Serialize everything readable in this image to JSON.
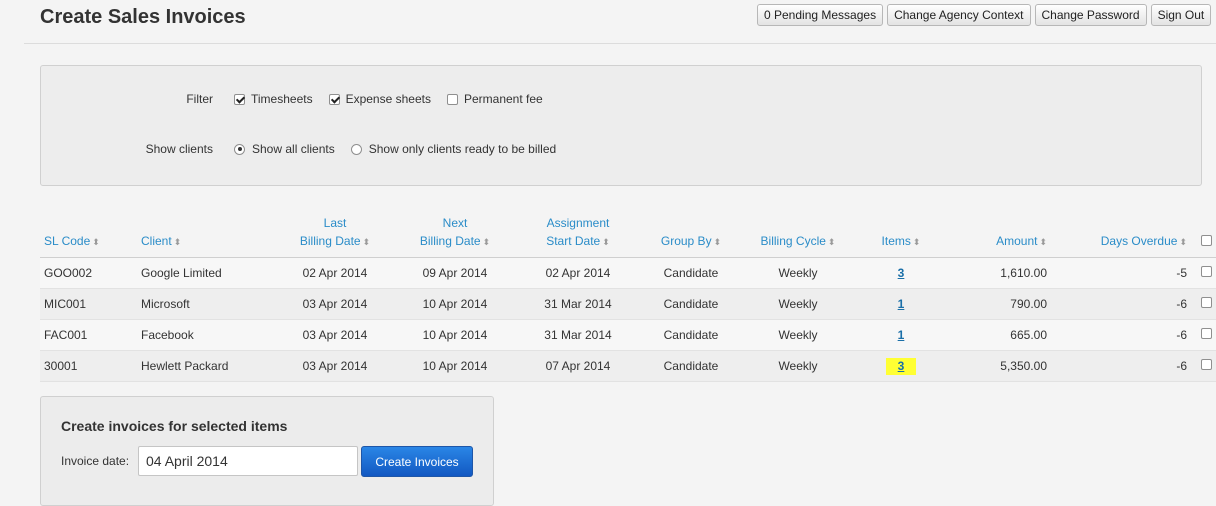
{
  "page": {
    "title": "Create Sales Invoices"
  },
  "top_buttons": {
    "pending": "0 Pending Messages",
    "agency": "Change Agency Context",
    "password": "Change Password",
    "signout": "Sign Out"
  },
  "filter": {
    "filter_label": "Filter",
    "timesheets": {
      "label": "Timesheets",
      "checked": true
    },
    "expense": {
      "label": "Expense sheets",
      "checked": true
    },
    "permanent": {
      "label": "Permanent fee",
      "checked": false
    },
    "show_clients_label": "Show clients",
    "show_all": {
      "label": "Show all clients",
      "selected": true
    },
    "show_ready": {
      "label": "Show only clients ready to be billed",
      "selected": false
    }
  },
  "table": {
    "headers": {
      "sl_code": "SL Code",
      "client": "Client",
      "last_billing_1": "Last",
      "last_billing_2": "Billing Date",
      "next_billing_1": "Next",
      "next_billing_2": "Billing Date",
      "assignment_1": "Assignment",
      "assignment_2": "Start Date",
      "group_by": "Group By",
      "billing_cycle": "Billing Cycle",
      "items": "Items",
      "amount": "Amount",
      "days_overdue": "Days Overdue"
    },
    "rows": [
      {
        "sl_code": "GOO002",
        "client": "Google Limited",
        "last": "02 Apr 2014",
        "next": "09 Apr 2014",
        "start": "02 Apr 2014",
        "group": "Candidate",
        "cycle": "Weekly",
        "items": "3",
        "amount": "1,610.00",
        "overdue": "-5"
      },
      {
        "sl_code": "MIC001",
        "client": "Microsoft",
        "last": "03 Apr 2014",
        "next": "10 Apr 2014",
        "start": "31 Mar 2014",
        "group": "Candidate",
        "cycle": "Weekly",
        "items": "1",
        "amount": "790.00",
        "overdue": "-6"
      },
      {
        "sl_code": "FAC001",
        "client": "Facebook",
        "last": "03 Apr 2014",
        "next": "10 Apr 2014",
        "start": "31 Mar 2014",
        "group": "Candidate",
        "cycle": "Weekly",
        "items": "1",
        "amount": "665.00",
        "overdue": "-6"
      },
      {
        "sl_code": "30001",
        "client": "Hewlett Packard",
        "last": "03 Apr 2014",
        "next": "10 Apr 2014",
        "start": "07 Apr 2014",
        "group": "Candidate",
        "cycle": "Weekly",
        "items": "3",
        "amount": "5,350.00",
        "overdue": "-6"
      }
    ]
  },
  "create": {
    "title": "Create invoices for selected items",
    "date_label": "Invoice date:",
    "date_value": "04 April 2014",
    "button": "Create Invoices"
  },
  "colors": {
    "header_link": "#2a8cc8",
    "button_primary": "#1a6fd4",
    "highlight": "#ffff33"
  }
}
